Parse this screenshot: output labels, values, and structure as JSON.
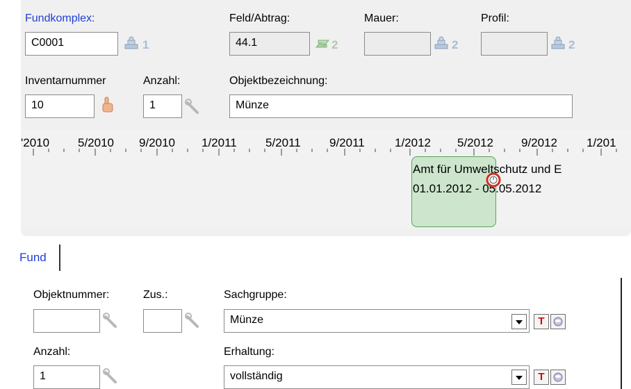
{
  "header": {
    "fundkomplex": {
      "label": "Fundkomplex:",
      "value": "C0001",
      "count": "1"
    },
    "feld": {
      "label": "Feld/Abtrag:",
      "value": "44.1",
      "count": "2"
    },
    "mauer": {
      "label": "Mauer:",
      "value": "",
      "count": "2"
    },
    "profil": {
      "label": "Profil:",
      "value": "",
      "count": "2"
    },
    "inventar": {
      "label": "Inventarnummer",
      "value": "10"
    },
    "anzahl": {
      "label": "Anzahl:",
      "value": "1"
    },
    "objekt": {
      "label": "Objektbezeichnung:",
      "value": "Münze"
    }
  },
  "timeline": {
    "ticks": [
      "'2010",
      "5/2010",
      "9/2010",
      "1/2011",
      "5/2011",
      "9/2011",
      "1/2012",
      "5/2012",
      "9/2012",
      "1/201"
    ],
    "event": {
      "title": "Amt für Umweltschutz und E",
      "range": "01.01.2012 - 05.05.2012"
    }
  },
  "tabs": [
    {
      "label": "Fund"
    }
  ],
  "fund": {
    "objektnummer": {
      "label": "Objektnummer:",
      "value": ""
    },
    "zus": {
      "label": "Zus.:",
      "value": ""
    },
    "sachgruppe": {
      "label": "Sachgruppe:",
      "value": "Münze"
    },
    "anzahl": {
      "label": "Anzahl:",
      "value": "1"
    },
    "erhaltung": {
      "label": "Erhaltung:",
      "value": "vollständig"
    },
    "t_label": "T"
  },
  "colors": {
    "link": "#1f3fd6",
    "event_fill": "#cde5cd",
    "event_border": "#5ca05c",
    "count": "#a9bcd6"
  }
}
